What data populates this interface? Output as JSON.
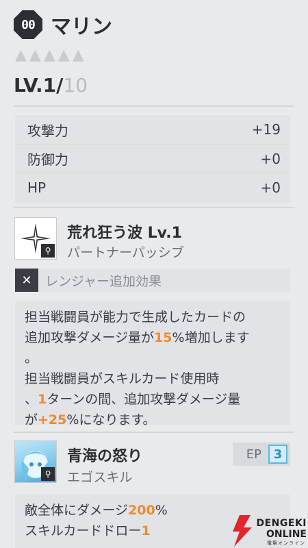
{
  "character": {
    "code": "00",
    "name": "マリン",
    "stars": 5,
    "level_label": "LV.1/",
    "level_max": "10"
  },
  "stats": [
    {
      "label": "攻撃力",
      "value": "+19"
    },
    {
      "label": "防御力",
      "value": "+0"
    },
    {
      "label": "HP",
      "value": "+0"
    }
  ],
  "passive": {
    "title": "荒れ狂う波 Lv.1",
    "subtitle": "パートナーパッシブ",
    "ranger_label": "レンジャー追加効果",
    "desc": {
      "l1": "担当戦闘員が能力で生成したカードの",
      "l2a": "追加攻撃ダメージ量が",
      "l2b": "15",
      "l2c": "%増加します",
      "l3": "。",
      "l4": "担当戦闘員がスキルカード使用時",
      "l5a": "、",
      "l5b": "1",
      "l5c": "ターンの間、追加攻撃ダメージ量",
      "l6a": "が",
      "l6b": "+25",
      "l6c": "%になります。"
    }
  },
  "ego": {
    "title": "青海の怒り",
    "subtitle": "エゴスキル",
    "ep_label": "EP",
    "ep_value": "3",
    "desc": {
      "l1a": "敵全体にダメージ",
      "l1b": "200",
      "l1c": "%",
      "l2a": "スキルカードドロー",
      "l2b": "1"
    }
  },
  "watermark": {
    "line1": "DENGEKI",
    "line2": "ONLINE",
    "line3": "電撃オンライン"
  },
  "colors": {
    "highlight": "#f08a2e",
    "ep_accent": "#5bb8e0"
  },
  "icons": {
    "magnify": "magnify-icon",
    "sparkle": "sparkle-icon",
    "ranger": "crossed-blades-icon"
  }
}
